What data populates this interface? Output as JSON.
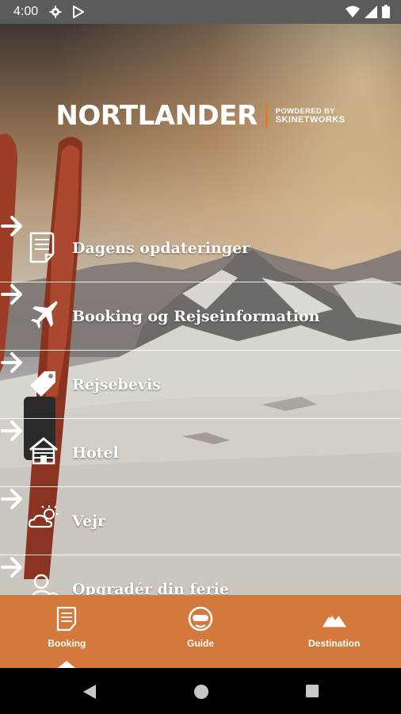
{
  "status_bar": {
    "time": "4:00",
    "icons": [
      "settings-icon",
      "play-store-icon",
      "wifi-icon",
      "signal-icon",
      "battery-icon"
    ]
  },
  "logo": {
    "word": "NORTLANDER",
    "powered_line1": "POWDERED BY",
    "powered_line2": "SKINETWORKS",
    "accent_color": "#e07a2c"
  },
  "menu": {
    "items": [
      {
        "label": "Dagens opdateringer",
        "icon": "document-icon"
      },
      {
        "label": "Booking og Rejseinformation",
        "icon": "airplane-icon"
      },
      {
        "label": "Rejsebevis",
        "icon": "tag-icon"
      },
      {
        "label": "Hotel",
        "icon": "house-icon"
      },
      {
        "label": "Vejr",
        "icon": "weather-icon"
      },
      {
        "label": "Opgradér din ferie",
        "icon": "user-add-icon"
      }
    ]
  },
  "bottom_nav": {
    "color": "#d2793b",
    "tabs": [
      {
        "label": "Booking",
        "icon": "document-icon",
        "active": true
      },
      {
        "label": "Guide",
        "icon": "skier-icon",
        "active": false
      },
      {
        "label": "Destination",
        "icon": "mountain-icon",
        "active": false
      }
    ]
  },
  "system_nav": {
    "buttons": [
      "back-icon",
      "home-icon",
      "recents-icon"
    ]
  }
}
